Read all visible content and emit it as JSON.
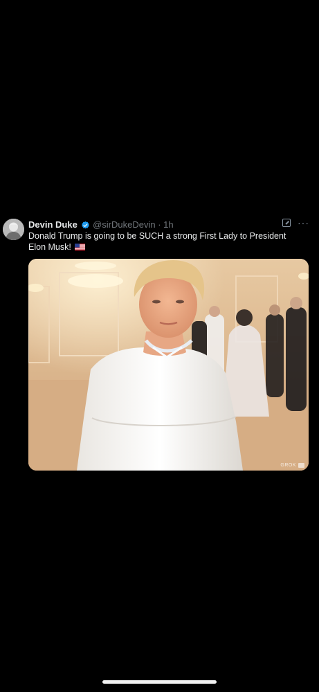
{
  "tweet": {
    "author_name": "Devin Duke",
    "handle": "@sirDukeDevin",
    "separator": "·",
    "time": "1h",
    "text": "Donald Trump is going to be SUCH a strong First Lady to President Elon Musk!",
    "flag_icon": "us-flag-emoji"
  },
  "media": {
    "watermark": "GROK"
  },
  "colors": {
    "background": "#000000",
    "verified": "#1d9bf0",
    "secondary_text": "#71767b"
  }
}
